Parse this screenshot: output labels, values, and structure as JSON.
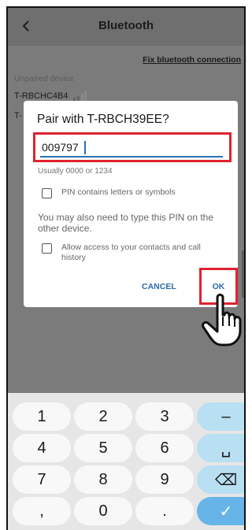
{
  "appbar": {
    "title": "Bluetooth",
    "back_icon": "chevron-left-icon"
  },
  "background": {
    "fix_link": "Fix bluetooth connection",
    "section_label": "Unpaired device",
    "devices": [
      {
        "name": "T-RBCHC4B4"
      },
      {
        "name": "T-"
      }
    ]
  },
  "dialog": {
    "title": "Pair with T-RBCH39EE?",
    "pin_value": "009797",
    "hint": "Usually 0000 or 1234",
    "checkbox_pin_letters": "PIN contains letters or symbols",
    "note": "You may also need to type this PIN on the other device.",
    "checkbox_allow_contacts": "Allow access to your contacts and call history",
    "cancel_label": "CANCEL",
    "ok_label": "OK"
  },
  "keyboard": {
    "rows": [
      [
        "1",
        "2",
        "3",
        "–"
      ],
      [
        "4",
        "5",
        "6",
        "␣"
      ],
      [
        "7",
        "8",
        "9",
        "⌫"
      ],
      [
        ",",
        "0",
        ".",
        "✓"
      ]
    ]
  },
  "colors": {
    "highlight": "#e0222e",
    "accent": "#2a72b8",
    "confirm_key": "#67b4e8",
    "action_key": "#b9dff2"
  }
}
